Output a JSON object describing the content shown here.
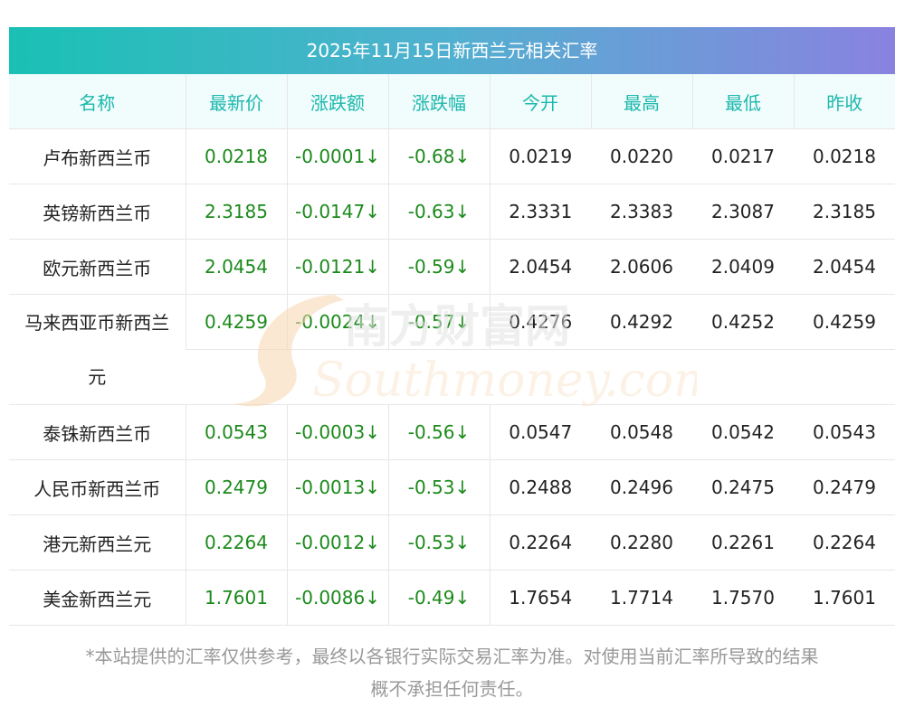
{
  "title": "2025年11月15日新西兰元相关汇率",
  "columns": [
    "名称",
    "最新价",
    "涨跌额",
    "涨跌幅",
    "今开",
    "最高",
    "最低",
    "昨收"
  ],
  "rows": [
    {
      "name": "卢布新西兰币",
      "latest": "0.0218",
      "change": "-0.0001↓",
      "pct": "-0.68↓",
      "open": "0.0219",
      "high": "0.0220",
      "low": "0.0217",
      "prev": "0.0218"
    },
    {
      "name": "英镑新西兰币",
      "latest": "2.3185",
      "change": "-0.0147↓",
      "pct": "-0.63↓",
      "open": "2.3331",
      "high": "2.3383",
      "low": "2.3087",
      "prev": "2.3185"
    },
    {
      "name": "欧元新西兰币",
      "latest": "2.0454",
      "change": "-0.0121↓",
      "pct": "-0.59↓",
      "open": "2.0454",
      "high": "2.0606",
      "low": "2.0409",
      "prev": "2.0454"
    },
    {
      "name_line1": "马来西亚币新西兰",
      "name_line2": "元",
      "latest": "0.4259",
      "change": "-0.0024↓",
      "pct": "-0.57↓",
      "open": "0.4276",
      "high": "0.4292",
      "low": "0.4252",
      "prev": "0.4259"
    },
    {
      "name": "泰铢新西兰币",
      "latest": "0.0543",
      "change": "-0.0003↓",
      "pct": "-0.56↓",
      "open": "0.0547",
      "high": "0.0548",
      "low": "0.0542",
      "prev": "0.0543"
    },
    {
      "name": "人民币新西兰币",
      "latest": "0.2479",
      "change": "-0.0013↓",
      "pct": "-0.53↓",
      "open": "0.2488",
      "high": "0.2496",
      "low": "0.2475",
      "prev": "0.2479"
    },
    {
      "name": "港元新西兰元",
      "latest": "0.2264",
      "change": "-0.0012↓",
      "pct": "-0.53↓",
      "open": "0.2264",
      "high": "0.2280",
      "low": "0.2261",
      "prev": "0.2264"
    },
    {
      "name": "美金新西兰元",
      "latest": "1.7601",
      "change": "-0.0086↓",
      "pct": "-0.49↓",
      "open": "1.7654",
      "high": "1.7714",
      "low": "1.7570",
      "prev": "1.7601"
    }
  ],
  "footnote_line1": "*本站提供的汇率仅供参考，最终以各银行实际交易汇率为准。对使用当前汇率所导致的结果",
  "footnote_line2": "概不承担任何责任。",
  "watermark": {
    "cn": "南方财富网",
    "en": "Southmoney.com"
  },
  "colors": {
    "header_text": "#1cb8ad",
    "green": "#1c8a1c",
    "title_gradient_start": "#19c1b4",
    "title_gradient_end": "#8a82e0"
  }
}
